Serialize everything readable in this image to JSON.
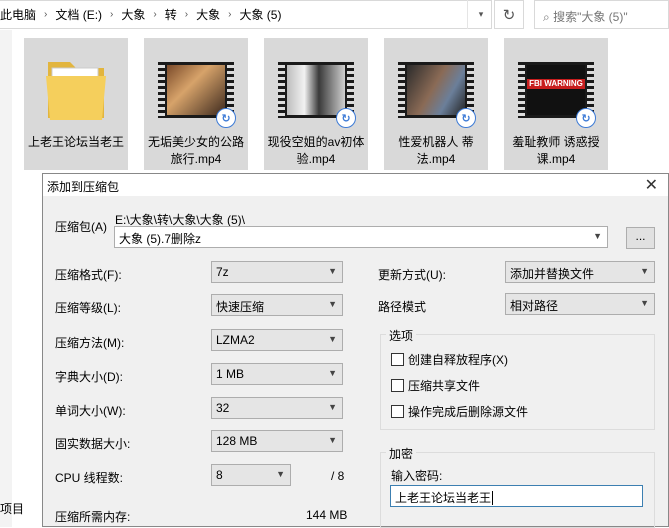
{
  "explorer": {
    "breadcrumb": [
      "此电脑",
      "文档 (E:)",
      "大象",
      "转",
      "大象",
      "大象 (5)"
    ],
    "search_placeholder": "搜索\"大象 (5)\"",
    "left_pane_partial_label": "项目",
    "files": [
      {
        "name": "上老王论坛当老王",
        "type": "folder"
      },
      {
        "name": "无垢美少女的公路旅行.mp4",
        "type": "video"
      },
      {
        "name": "现役空姐的av初体验.mp4",
        "type": "video"
      },
      {
        "name": "性爱机器人 蒂法.mp4",
        "type": "video"
      },
      {
        "name": "羞耻教师 诱惑授课.mp4",
        "type": "video",
        "thumb_text": "FBI WARNING"
      }
    ]
  },
  "dialog": {
    "title": "添加到压缩包",
    "archive_label": "压缩包(A)",
    "archive_path": "E:\\大象\\转\\大象\\大象 (5)\\",
    "archive_name": "大象 (5).7删除z",
    "browse_label": "...",
    "format_label": "压缩格式(F):",
    "format_value": "7z",
    "level_label": "压缩等级(L):",
    "level_value": "快速压缩",
    "method_label": "压缩方法(M):",
    "method_value": "LZMA2",
    "dict_label": "字典大小(D):",
    "dict_value": "1 MB",
    "word_label": "单词大小(W):",
    "word_value": "32",
    "solid_label": "固实数据大小:",
    "solid_value": "128 MB",
    "cpu_label": "CPU 线程数:",
    "cpu_value": "8",
    "cpu_max": "/ 8",
    "memory_label": "压缩所需内存:",
    "memory_value": "144 MB",
    "update_label": "更新方式(U):",
    "update_value": "添加并替换文件",
    "path_label": "路径模式",
    "path_value": "相对路径",
    "options_title": "选项",
    "opt_sfx": "创建自释放程序(X)",
    "opt_shared": "压缩共享文件",
    "opt_delete": "操作完成后删除源文件",
    "encrypt_title": "加密",
    "password_label": "输入密码:",
    "password_value": "上老王论坛当老王"
  }
}
